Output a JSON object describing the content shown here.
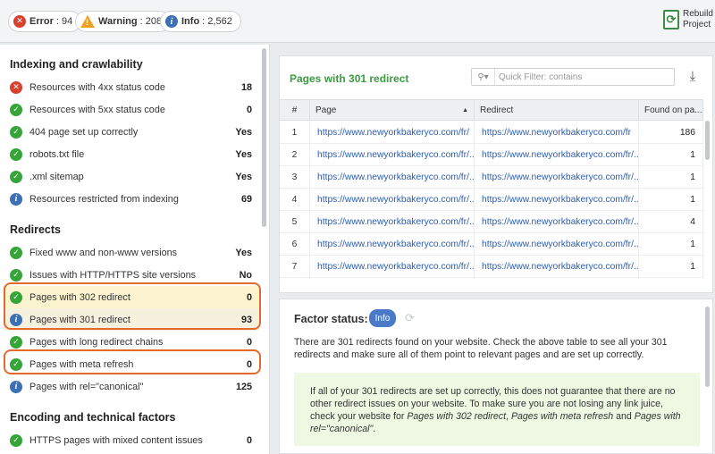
{
  "status_bar": {
    "error_label": "Error",
    "error_count": "94",
    "warning_label": "Warning",
    "warning_count": "208",
    "info_label": "Info",
    "info_count": "2,562",
    "rebuild_label": "Rebuild Project"
  },
  "left_panel": {
    "sections": [
      {
        "title": "Indexing and crawlability"
      },
      {
        "title": "Redirects"
      },
      {
        "title": "Encoding and technical factors"
      }
    ],
    "items": [
      {
        "status": "error",
        "label": "Resources with 4xx status code",
        "value": "18"
      },
      {
        "status": "ok",
        "label": "Resources with 5xx status code",
        "value": "0"
      },
      {
        "status": "ok",
        "label": "404 page set up correctly",
        "value": "Yes"
      },
      {
        "status": "ok",
        "label": "robots.txt file",
        "value": "Yes"
      },
      {
        "status": "ok",
        "label": ".xml sitemap",
        "value": "Yes"
      },
      {
        "status": "info",
        "label": "Resources restricted from indexing",
        "value": "69"
      },
      {
        "status": "ok",
        "label": "Fixed www and non-www versions",
        "value": "Yes"
      },
      {
        "status": "ok",
        "label": "Issues with HTTP/HTTPS site versions",
        "value": "No"
      },
      {
        "status": "ok",
        "label": "Pages with 302 redirect",
        "value": "0"
      },
      {
        "status": "info",
        "label": "Pages with 301 redirect",
        "value": "93"
      },
      {
        "status": "ok",
        "label": "Pages with long redirect chains",
        "value": "0"
      },
      {
        "status": "ok",
        "label": "Pages with meta refresh",
        "value": "0"
      },
      {
        "status": "info",
        "label": "Pages with rel=\"canonical\"",
        "value": "125"
      },
      {
        "status": "ok",
        "label": "HTTPS pages with mixed content issues",
        "value": "0"
      }
    ]
  },
  "table_panel": {
    "title": "Pages with 301 redirect",
    "filter_placeholder": "Quick Filter: contains",
    "columns": {
      "num": "#",
      "page": "Page",
      "redirect": "Redirect",
      "found": "Found on pa..."
    },
    "rows": [
      {
        "num": "1",
        "page": "https://www.newyorkbakeryco.com/fr/",
        "redirect": "https://www.newyorkbakeryco.com/fr",
        "found": "186"
      },
      {
        "num": "2",
        "page": "https://www.newyorkbakeryco.com/fr/...",
        "redirect": "https://www.newyorkbakeryco.com/fr/...",
        "found": "1"
      },
      {
        "num": "3",
        "page": "https://www.newyorkbakeryco.com/fr/...",
        "redirect": "https://www.newyorkbakeryco.com/fr/...",
        "found": "1"
      },
      {
        "num": "4",
        "page": "https://www.newyorkbakeryco.com/fr/...",
        "redirect": "https://www.newyorkbakeryco.com/fr/...",
        "found": "1"
      },
      {
        "num": "5",
        "page": "https://www.newyorkbakeryco.com/fr/...",
        "redirect": "https://www.newyorkbakeryco.com/fr/...",
        "found": "4"
      },
      {
        "num": "6",
        "page": "https://www.newyorkbakeryco.com/fr/...",
        "redirect": "https://www.newyorkbakeryco.com/fr/...",
        "found": "1"
      },
      {
        "num": "7",
        "page": "https://www.newyorkbakeryco.com/fr/...",
        "redirect": "https://www.newyorkbakeryco.com/fr/...",
        "found": "1"
      }
    ]
  },
  "factor_panel": {
    "title": "Factor status:",
    "badge": "Info",
    "description": "There are 301 redirects found on your website. Check the above table to see all your 301 redirects and make sure all of them point to relevant pages and are set up correctly.",
    "note_prefix": "If all of your 301 redirects are set up correctly, this does not guarantee that there are no other redirect issues on your website. To make sure you are not losing any link juice, check your website for ",
    "note_link1": "Pages with 302 redirect",
    "note_sep1": ", ",
    "note_link2": "Pages with meta refresh",
    "note_sep2": " and ",
    "note_link3": "Pages with rel=\"canonical\"",
    "note_suffix": "."
  },
  "colors": {
    "accent_green": "#3c9a3f",
    "error_red": "#d9412f",
    "info_blue": "#3b6fb6",
    "highlight_orange": "#e36a2c"
  }
}
